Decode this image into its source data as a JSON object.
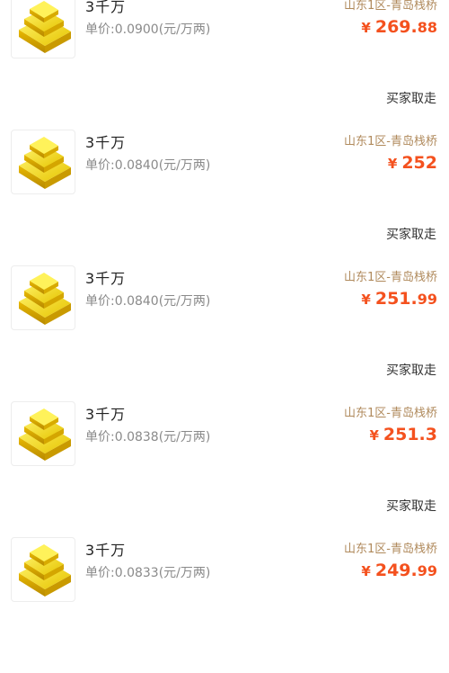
{
  "listings": [
    {
      "title": "3千万",
      "unit_price": "单价:0.0900(元/万两)",
      "server": "山东1区-青岛栈桥",
      "currency": "¥",
      "amount_int": "269.",
      "amount_dec": "88",
      "status": "买家取走",
      "icon": "gold-ingot-icon"
    },
    {
      "title": "3千万",
      "unit_price": "单价:0.0840(元/万两)",
      "server": "山东1区-青岛栈桥",
      "currency": "¥",
      "amount_int": "252",
      "amount_dec": "",
      "status": "买家取走",
      "icon": "gold-ingot-icon"
    },
    {
      "title": "3千万",
      "unit_price": "单价:0.0840(元/万两)",
      "server": "山东1区-青岛栈桥",
      "currency": "¥",
      "amount_int": "251.",
      "amount_dec": "99",
      "status": "买家取走",
      "icon": "gold-ingot-icon"
    },
    {
      "title": "3千万",
      "unit_price": "单价:0.0838(元/万两)",
      "server": "山东1区-青岛栈桥",
      "currency": "¥",
      "amount_int": "251.3",
      "amount_dec": "",
      "status": "买家取走",
      "icon": "gold-ingot-icon"
    },
    {
      "title": "3千万",
      "unit_price": "单价:0.0833(元/万两)",
      "server": "山东1区-青岛栈桥",
      "currency": "¥",
      "amount_int": "249.",
      "amount_dec": "99",
      "status": "",
      "icon": "gold-ingot-icon"
    }
  ],
  "colors": {
    "price": "#f4511e",
    "server": "#b08a5c",
    "gold": "#f2d600"
  }
}
